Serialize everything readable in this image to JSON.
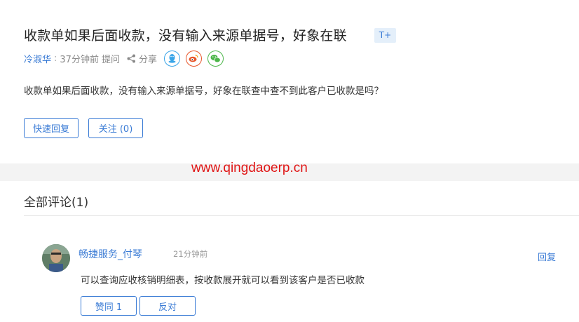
{
  "question": {
    "title": "收款单如果后面收款，没有输入来源单据号，好象在联",
    "font_toggle": "T+",
    "author": "冷淑华",
    "separator": ":",
    "time": "37分钟前",
    "action": "提问",
    "share_label": "分享",
    "body": "收款单如果后面收款，没有输入来源单据号，好象在联查中查不到此客户已收款是吗？",
    "quick_reply_label": "快速回复",
    "follow_label": "关注 (0)"
  },
  "watermark": "www.qingdaoerp.cn",
  "comments_section": {
    "heading": "全部评论(1)",
    "items": [
      {
        "user": "畅捷服务_付琴",
        "time": "21分钟前",
        "reply_label": "回复",
        "text": "可以查询应收核销明细表，按收款展开就可以看到该客户是否已收款",
        "agree_label": "赞同 1",
        "oppose_label": "反对"
      }
    ]
  },
  "colors": {
    "accent": "#3a7bd5",
    "watermark": "#e01515",
    "qq": "#3aa5e8",
    "weibo": "#e8562a",
    "wechat": "#4cb649"
  },
  "icons": [
    "share-icon",
    "qq-icon",
    "weibo-icon",
    "wechat-icon",
    "avatar"
  ]
}
